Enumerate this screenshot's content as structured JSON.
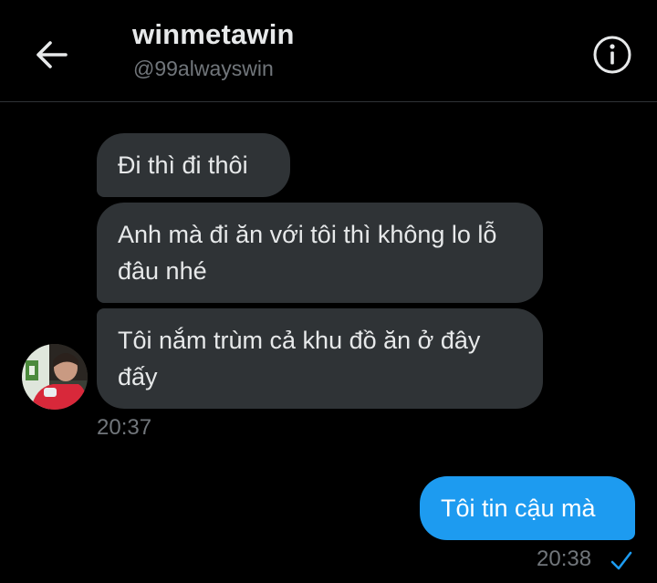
{
  "header": {
    "title": "winmetawin",
    "handle": "@99alwayswin",
    "back_icon": "arrow-left-icon",
    "info_icon": "info-circle-icon"
  },
  "messages": [
    {
      "direction": "received",
      "text": "Đi thì đi thôi"
    },
    {
      "direction": "received",
      "text": "Anh mà đi ăn với tôi thì không lo lỗ đâu nhé"
    },
    {
      "direction": "received",
      "text": "Tôi nắm trùm cả khu đồ ăn ở đây đấy"
    },
    {
      "direction": "sent",
      "text": "Tôi tin cậu mà"
    }
  ],
  "timestamps": {
    "received": "20:37",
    "sent": "20:38"
  },
  "status_icon": "checkmark-icon",
  "colors": {
    "background": "#000000",
    "received_bubble": "#2f3336",
    "sent_bubble": "#1d9bf0",
    "secondary_text": "#71767b",
    "divider": "#2f3336"
  }
}
